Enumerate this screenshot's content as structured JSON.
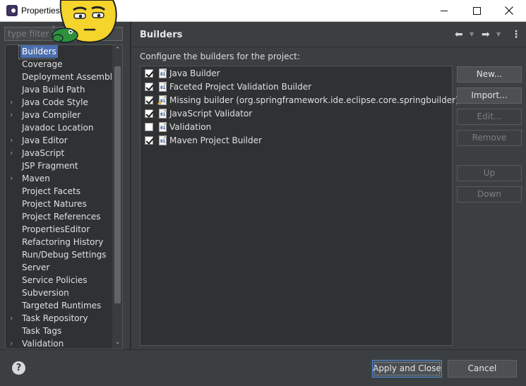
{
  "window": {
    "title": "Properties",
    "icon": "eclipse-icon",
    "controls": {
      "minimize": "minimize-icon",
      "maximize": "maximize-icon",
      "close": "close-icon"
    }
  },
  "filter": {
    "placeholder": "type filter text",
    "value": ""
  },
  "nav": {
    "items": [
      {
        "label": "Builders",
        "expandable": false,
        "selected": true
      },
      {
        "label": "Coverage",
        "expandable": false
      },
      {
        "label": "Deployment Assembly",
        "expandable": false
      },
      {
        "label": "Java Build Path",
        "expandable": false
      },
      {
        "label": "Java Code Style",
        "expandable": true
      },
      {
        "label": "Java Compiler",
        "expandable": true
      },
      {
        "label": "Javadoc Location",
        "expandable": false
      },
      {
        "label": "Java Editor",
        "expandable": true
      },
      {
        "label": "JavaScript",
        "expandable": true
      },
      {
        "label": "JSP Fragment",
        "expandable": false
      },
      {
        "label": "Maven",
        "expandable": true
      },
      {
        "label": "Project Facets",
        "expandable": false
      },
      {
        "label": "Project Natures",
        "expandable": false
      },
      {
        "label": "Project References",
        "expandable": false
      },
      {
        "label": "PropertiesEditor",
        "expandable": false
      },
      {
        "label": "Refactoring History",
        "expandable": false
      },
      {
        "label": "Run/Debug Settings",
        "expandable": false
      },
      {
        "label": "Server",
        "expandable": false
      },
      {
        "label": "Service Policies",
        "expandable": false
      },
      {
        "label": "Subversion",
        "expandable": false
      },
      {
        "label": "Targeted Runtimes",
        "expandable": false
      },
      {
        "label": "Task Repository",
        "expandable": true
      },
      {
        "label": "Task Tags",
        "expandable": false
      },
      {
        "label": "Validation",
        "expandable": true
      }
    ]
  },
  "page": {
    "title": "Builders",
    "description": "Configure the builders for the project:",
    "nav_icons": {
      "back": "back-arrow-icon",
      "forward": "forward-arrow-icon",
      "menu": "view-menu-icon"
    }
  },
  "builders": [
    {
      "label": "Java Builder",
      "checked": true,
      "warning": false
    },
    {
      "label": "Faceted Project Validation Builder",
      "checked": true,
      "warning": false
    },
    {
      "label": "Missing builder (org.springframework.ide.eclipse.core.springbuilder)",
      "checked": true,
      "warning": true
    },
    {
      "label": "JavaScript Validator",
      "checked": true,
      "warning": false
    },
    {
      "label": "Validation",
      "checked": false,
      "warning": false
    },
    {
      "label": "Maven Project Builder",
      "checked": true,
      "warning": false
    }
  ],
  "buttons": {
    "new": "New...",
    "import": "Import...",
    "edit": "Edit...",
    "remove": "Remove",
    "up": "Up",
    "down": "Down",
    "apply_close": "Apply and Close",
    "cancel": "Cancel",
    "help": "?"
  }
}
